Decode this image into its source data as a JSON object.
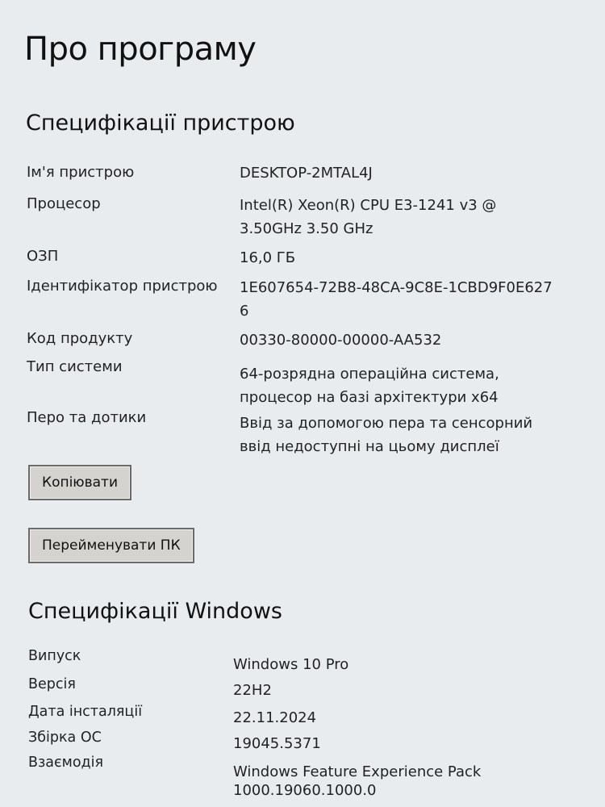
{
  "page": {
    "title": "Про програму"
  },
  "device_specs": {
    "heading": "Специфікації пристрою",
    "rows": [
      {
        "label": "Ім'я пристрою",
        "value": "DESKTOP-2MTAL4J"
      },
      {
        "label": "Процесор",
        "value": "Intel(R) Xeon(R) CPU E3-1241 v3 @ 3.50GHz   3.50 GHz"
      },
      {
        "label": "ОЗП",
        "value": "16,0 ГБ"
      },
      {
        "label": "Ідентифікатор пристрою",
        "value": "1E607654-72B8-48CA-9C8E-1CBD9F0E6276"
      },
      {
        "label": "Код продукту",
        "value": "00330-80000-00000-AA532"
      },
      {
        "label": "Тип системи",
        "value": "64-розрядна операційна система, процесор на базі архітектури x64"
      },
      {
        "label": "Перо та дотики",
        "value": "Ввід за допомогою пера та сенсорний ввід недоступні на цьому дисплеї"
      }
    ]
  },
  "buttons": {
    "copy_label": "Копіювати",
    "rename_label": "Перейменувати ПК"
  },
  "windows_specs": {
    "heading": "Специфікації Windows",
    "rows": [
      {
        "label": "Випуск",
        "value": "Windows 10 Pro"
      },
      {
        "label": "Версія",
        "value": "22H2"
      },
      {
        "label": "Дата інсталяції",
        "value": "22.11.2024"
      },
      {
        "label": "Збірка ОС",
        "value": "19045.5371"
      },
      {
        "label": "Взаємодія",
        "value": "Windows Feature Experience Pack 1000.19060.1000.0"
      }
    ]
  }
}
